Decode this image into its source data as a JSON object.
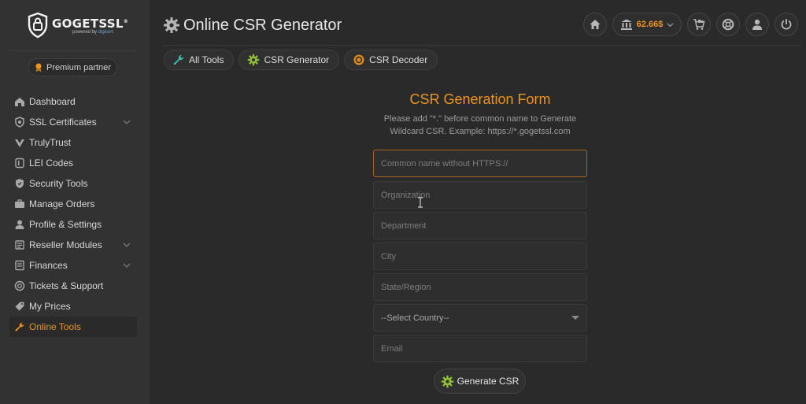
{
  "brand": {
    "name": "GOGETSSL",
    "registered": "®",
    "powered_prefix": "powered by",
    "powered_brand": "digicert"
  },
  "partner_badge": "Premium partner",
  "sidebar": {
    "items": [
      {
        "label": "Dashboard",
        "icon": "dashboard-icon",
        "expandable": false
      },
      {
        "label": "SSL Certificates",
        "icon": "certificate-icon",
        "expandable": true
      },
      {
        "label": "TrulyTrust",
        "icon": "trulytrust-icon",
        "expandable": false
      },
      {
        "label": "LEI Codes",
        "icon": "lei-icon",
        "expandable": false
      },
      {
        "label": "Security Tools",
        "icon": "shield-icon",
        "expandable": false
      },
      {
        "label": "Manage Orders",
        "icon": "briefcase-icon",
        "expandable": false
      },
      {
        "label": "Profile & Settings",
        "icon": "user-icon",
        "expandable": false
      },
      {
        "label": "Reseller Modules",
        "icon": "modules-icon",
        "expandable": true
      },
      {
        "label": "Finances",
        "icon": "finances-icon",
        "expandable": true
      },
      {
        "label": "Tickets & Support",
        "icon": "support-icon",
        "expandable": false
      },
      {
        "label": "My Prices",
        "icon": "tag-icon",
        "expandable": false
      },
      {
        "label": "Online Tools",
        "icon": "wrench-icon",
        "expandable": false,
        "active": true
      }
    ]
  },
  "header": {
    "title": "Online CSR Generator",
    "balance": "62.66$"
  },
  "tool_tabs": [
    {
      "label": "All Tools",
      "icon": "wrench-icon"
    },
    {
      "label": "CSR Generator",
      "icon": "gear-icon"
    },
    {
      "label": "CSR Decoder",
      "icon": "decoder-icon"
    }
  ],
  "form": {
    "title": "CSR Generation Form",
    "hint_line1": "Please add \"*.\" before common name to Generate",
    "hint_line2": "Wildcard CSR. Example: https://*.gogetssl.com",
    "common_name_placeholder": "Common name without HTTPS://",
    "organization_placeholder": "Organization",
    "department_placeholder": "Department",
    "city_placeholder": "City",
    "state_placeholder": "State/Region",
    "country_selected": "--Select Country--",
    "email_placeholder": "Email",
    "submit_label": "Generate CSR"
  },
  "colors": {
    "accent": "#f0941e",
    "background": "#2a2a2a",
    "sidebar": "#323232",
    "gear_green": "#8fbf3a",
    "wrench_teal": "#3fb8b0"
  }
}
